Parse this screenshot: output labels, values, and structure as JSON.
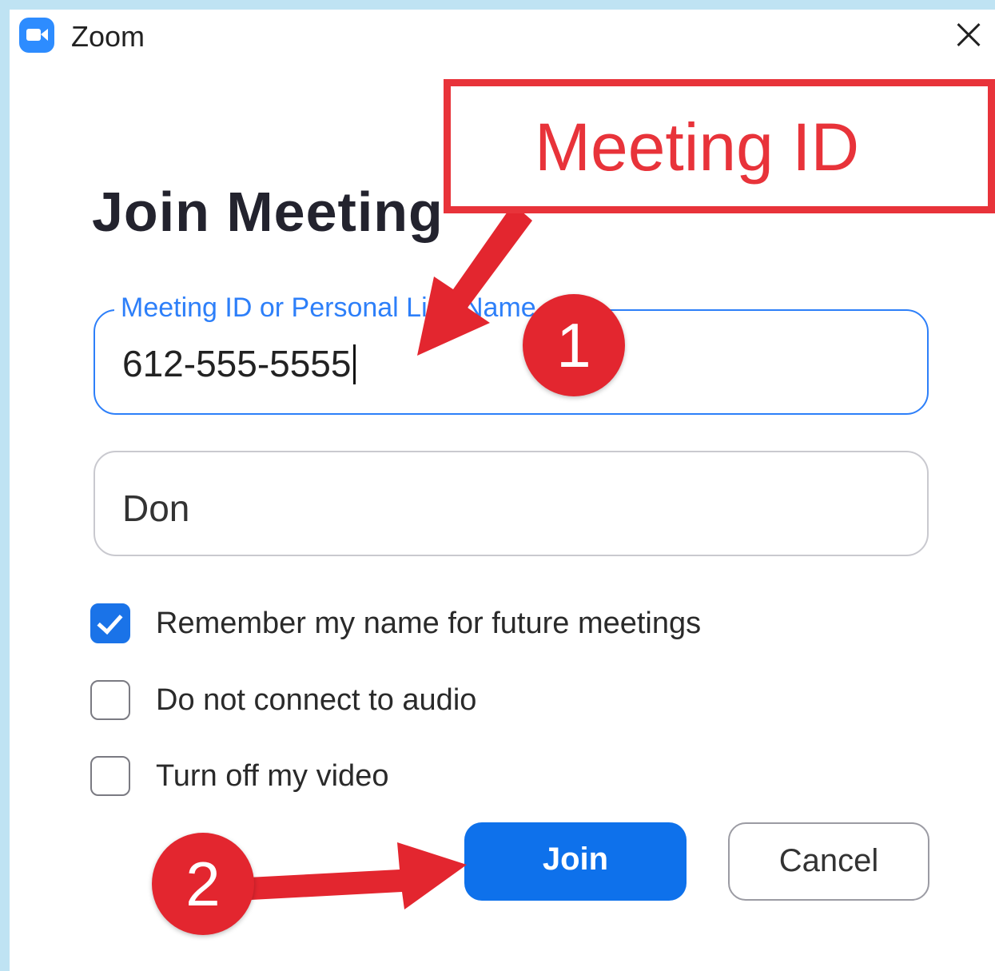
{
  "window": {
    "title": "Zoom",
    "icon": "zoom-camera-icon",
    "close_icon": "close-icon"
  },
  "dialog": {
    "heading": "Join Meeting",
    "meeting_id_field": {
      "label": "Meeting ID or Personal Link Name",
      "value": "612-555-5555"
    },
    "name_field": {
      "value": "Don"
    },
    "options": [
      {
        "label": "Remember my name for future meetings",
        "checked": true
      },
      {
        "label": "Do not connect to audio",
        "checked": false
      },
      {
        "label": "Turn off my video",
        "checked": false
      }
    ],
    "join_label": "Join",
    "cancel_label": "Cancel"
  },
  "annotations": {
    "callout_text": "Meeting ID",
    "step_1": "1",
    "step_2": "2",
    "color": "#e3262f"
  },
  "colors": {
    "accent": "#0e71eb",
    "focus_border": "#2d7ff9",
    "background": "#bfe3f3"
  }
}
